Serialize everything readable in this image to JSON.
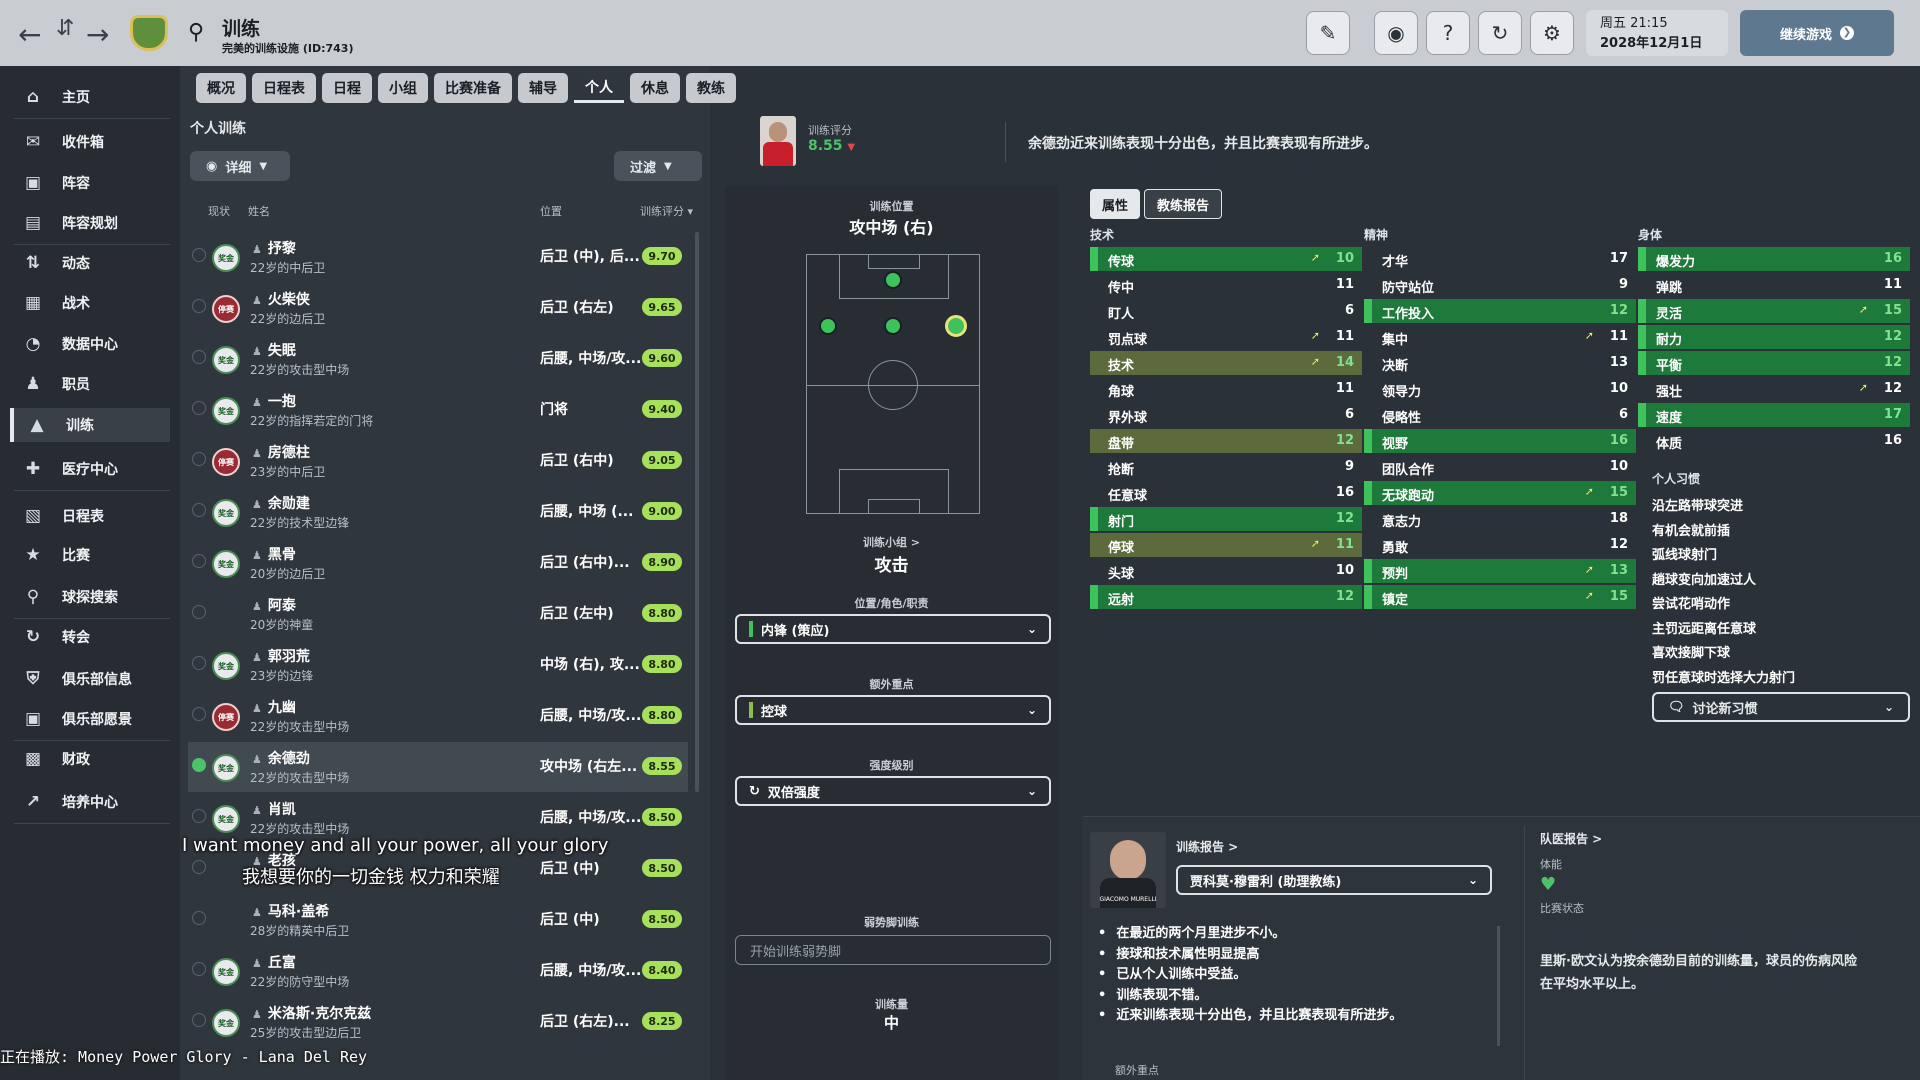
{
  "topbar": {
    "search_icon": "search-icon",
    "title": "训练",
    "subtitle": "完美的训练设施 (ID:743)",
    "date_line1": "周五 21:15",
    "date_line2": "2028年12月1日",
    "continue_label": "继续游戏",
    "icons": [
      "edit-icon",
      "globe-icon",
      "help-icon",
      "refresh-icon",
      "settings-icon"
    ]
  },
  "sidebar": {
    "items": [
      {
        "label": "主页",
        "icon": "home-icon"
      },
      {
        "label": "收件箱",
        "icon": "inbox-icon"
      },
      {
        "label": "阵容",
        "icon": "shirt-icon"
      },
      {
        "label": "阵容规划",
        "icon": "clipboard-icon"
      },
      {
        "label": "动态",
        "icon": "dynamic-icon"
      },
      {
        "label": "战术",
        "icon": "tactics-icon"
      },
      {
        "label": "数据中心",
        "icon": "data-icon"
      },
      {
        "label": "职员",
        "icon": "staff-icon"
      },
      {
        "label": "训练",
        "icon": "training-icon"
      },
      {
        "label": "医疗中心",
        "icon": "medical-icon"
      },
      {
        "label": "日程表",
        "icon": "calendar-icon"
      },
      {
        "label": "比赛",
        "icon": "trophy-icon"
      },
      {
        "label": "球探搜索",
        "icon": "scout-icon"
      },
      {
        "label": "转会",
        "icon": "transfer-icon"
      },
      {
        "label": "俱乐部信息",
        "icon": "shield-icon"
      },
      {
        "label": "俱乐部愿景",
        "icon": "vision-icon"
      },
      {
        "label": "财政",
        "icon": "finance-icon"
      },
      {
        "label": "培养中心",
        "icon": "development-icon"
      }
    ]
  },
  "tabs": [
    "概况",
    "日程表",
    "日程",
    "小组",
    "比赛准备",
    "辅导",
    "个人",
    "休息",
    "教练"
  ],
  "left": {
    "title": "个人训练",
    "detail_label": "详细",
    "filter_label": "过滤",
    "col_status": "现状",
    "col_name": "姓名",
    "col_pos": "位置",
    "col_rating": "训练评分",
    "players": [
      {
        "badge": "奖金",
        "name": "抒黎",
        "desc": "22岁的中后卫",
        "pos": "后卫 (中), 后...",
        "rating": "9.70"
      },
      {
        "badge": "停赛",
        "name": "火柴侠",
        "desc": "22岁的边后卫",
        "pos": "后卫 (右左)",
        "rating": "9.65"
      },
      {
        "badge": "奖金",
        "name": "失眠",
        "desc": "22岁的攻击型中场",
        "pos": "后腰, 中场/攻...",
        "rating": "9.60"
      },
      {
        "badge": "奖金",
        "name": "一抱",
        "desc": "22岁的指挥若定的门将",
        "pos": "门将",
        "rating": "9.40"
      },
      {
        "badge": "停赛",
        "name": "房德柱",
        "desc": "23岁的中后卫",
        "pos": "后卫 (右中)",
        "rating": "9.05"
      },
      {
        "badge": "奖金",
        "name": "余勋建",
        "desc": "22岁的技术型边锋",
        "pos": "后腰, 中场 (...",
        "rating": "9.00"
      },
      {
        "badge": "奖金",
        "name": "黑骨",
        "desc": "20岁的边后卫",
        "pos": "后卫 (右中)...",
        "rating": "8.90"
      },
      {
        "badge": "",
        "name": "阿泰",
        "desc": "20岁的神童",
        "pos": "后卫 (左中)",
        "rating": "8.80"
      },
      {
        "badge": "奖金",
        "name": "郭羽荒",
        "desc": "23岁的边锋",
        "pos": "中场 (右), 攻...",
        "rating": "8.80"
      },
      {
        "badge": "停赛",
        "name": "九幽",
        "desc": "22岁的攻击型中场",
        "pos": "后腰, 中场/攻...",
        "rating": "8.80"
      },
      {
        "badge": "奖金",
        "name": "余德劲",
        "desc": "22岁的攻击型中场",
        "pos": "攻中场 (右左...",
        "rating": "8.55"
      },
      {
        "badge": "奖金",
        "name": "肖凯",
        "desc": "22岁的攻击型中场",
        "pos": "后腰, 中场/攻...",
        "rating": "8.50"
      },
      {
        "badge": "",
        "name": "老孩",
        "desc": "",
        "pos": "后卫 (中)",
        "rating": "8.50"
      },
      {
        "badge": "",
        "name": "马科·盖希",
        "desc": "28岁的精英中后卫",
        "pos": "后卫 (中)",
        "rating": "8.50"
      },
      {
        "badge": "奖金",
        "name": "丘富",
        "desc": "22岁的防守型中场",
        "pos": "后腰, 中场/攻...",
        "rating": "8.40"
      },
      {
        "badge": "奖金",
        "name": "米洛斯·克尔克兹",
        "desc": "25岁的攻击型边后卫",
        "pos": "后卫 (右左)...",
        "rating": "8.25"
      }
    ]
  },
  "overlay": {
    "subtitle_en": "I want money and all your power, all your glory",
    "subtitle_zh": "我想要你的一切金钱 权力和荣耀",
    "now_playing": "正在播放: Money Power Glory - Lana Del Rey"
  },
  "player_header": {
    "rating_label": "训练评分",
    "rating_value": "8.55",
    "comment": "余德劲近来训练表现十分出色，并且比赛表现有所进步。"
  },
  "middle": {
    "pos_label": "训练位置",
    "pos_value": "攻中场 (右)",
    "group_label": "训练小组 >",
    "group_value": "攻击",
    "role_label": "位置/角色/职责",
    "role_value": "内锋 (策应)",
    "focus_label": "额外重点",
    "focus_value": "控球",
    "intensity_label": "强度级别",
    "intensity_value": "双倍强度",
    "weakfoot_label": "弱势脚训练",
    "weakfoot_placeholder": "开始训练弱势脚",
    "load_label": "训练量",
    "load_value": "中"
  },
  "right": {
    "tab_attr": "属性",
    "tab_report": "教练报告",
    "tech_head": "技术",
    "mental_head": "精神",
    "physical_head": "身体",
    "technical": [
      {
        "n": "传球",
        "v": "10",
        "up": true,
        "hl": "g"
      },
      {
        "n": "传中",
        "v": "11",
        "up": false,
        "hl": ""
      },
      {
        "n": "盯人",
        "v": "6",
        "up": false,
        "hl": ""
      },
      {
        "n": "罚点球",
        "v": "11",
        "up": true,
        "hl": ""
      },
      {
        "n": "技术",
        "v": "14",
        "up": true,
        "hl": "o"
      },
      {
        "n": "角球",
        "v": "11",
        "up": false,
        "hl": ""
      },
      {
        "n": "界外球",
        "v": "6",
        "up": false,
        "hl": ""
      },
      {
        "n": "盘带",
        "v": "12",
        "up": false,
        "hl": "o"
      },
      {
        "n": "抢断",
        "v": "9",
        "up": false,
        "hl": ""
      },
      {
        "n": "任意球",
        "v": "16",
        "up": false,
        "hl": ""
      },
      {
        "n": "射门",
        "v": "12",
        "up": false,
        "hl": "g"
      },
      {
        "n": "停球",
        "v": "11",
        "up": true,
        "hl": "o"
      },
      {
        "n": "头球",
        "v": "10",
        "up": false,
        "hl": ""
      },
      {
        "n": "远射",
        "v": "12",
        "up": false,
        "hl": "g"
      }
    ],
    "mental": [
      {
        "n": "才华",
        "v": "17",
        "up": false,
        "hl": ""
      },
      {
        "n": "防守站位",
        "v": "9",
        "up": false,
        "hl": ""
      },
      {
        "n": "工作投入",
        "v": "12",
        "up": false,
        "hl": "g"
      },
      {
        "n": "集中",
        "v": "11",
        "up": true,
        "hl": ""
      },
      {
        "n": "决断",
        "v": "13",
        "up": false,
        "hl": ""
      },
      {
        "n": "领导力",
        "v": "10",
        "up": false,
        "hl": ""
      },
      {
        "n": "侵略性",
        "v": "6",
        "up": false,
        "hl": ""
      },
      {
        "n": "视野",
        "v": "16",
        "up": false,
        "hl": "g"
      },
      {
        "n": "团队合作",
        "v": "10",
        "up": false,
        "hl": ""
      },
      {
        "n": "无球跑动",
        "v": "15",
        "up": true,
        "hl": "g"
      },
      {
        "n": "意志力",
        "v": "18",
        "up": false,
        "hl": ""
      },
      {
        "n": "勇敢",
        "v": "12",
        "up": false,
        "hl": ""
      },
      {
        "n": "预判",
        "v": "13",
        "up": true,
        "hl": "g"
      },
      {
        "n": "镇定",
        "v": "15",
        "up": true,
        "hl": "g"
      }
    ],
    "physical": [
      {
        "n": "爆发力",
        "v": "16",
        "up": false,
        "hl": "g"
      },
      {
        "n": "弹跳",
        "v": "11",
        "up": false,
        "hl": ""
      },
      {
        "n": "灵活",
        "v": "15",
        "up": true,
        "hl": "g"
      },
      {
        "n": "耐力",
        "v": "12",
        "up": false,
        "hl": "g"
      },
      {
        "n": "平衡",
        "v": "12",
        "up": false,
        "hl": "g"
      },
      {
        "n": "强壮",
        "v": "12",
        "up": true,
        "hl": ""
      },
      {
        "n": "速度",
        "v": "17",
        "up": false,
        "hl": "g"
      },
      {
        "n": "体质",
        "v": "16",
        "up": false,
        "hl": ""
      }
    ],
    "habits_head": "个人习惯",
    "habits": [
      "沿左路带球突进",
      "有机会就前插",
      "弧线球射门",
      "趟球变向加速过人",
      "尝试花哨动作",
      "主罚远距离任意球",
      "喜欢接脚下球",
      "罚任意球时选择大力射门"
    ],
    "discuss_label": "讨论新习惯"
  },
  "report": {
    "link": "训练报告 >",
    "coach_select": "贾科莫·穆雷利 (助理教练)",
    "coach_caption": "GIACOMO MURELLI",
    "bullets": [
      "在最近的两个月里进步不小。",
      "接球和技术属性明显提高",
      "已从个人训练中受益。",
      "训练表现不错。",
      "近来训练表现十分出色，并且比赛表现有所进步。"
    ],
    "extra_label": "额外重点",
    "medical_link": "队医报告 >",
    "fitness_label": "体能",
    "match_label": "比赛状态",
    "medical_text_1": "里斯·欧文认为按余德劲目前的训练量，球员的伤病风险",
    "medical_text_2": "在平均水平以上。"
  },
  "colors": {
    "accent_green": "#3ec25c",
    "rating_green": "#a7e05a",
    "highlight": "#1e7a3a",
    "olive": "#5d6a3b",
    "rating_value": "#4ec16b",
    "down_arrow": "#e04848"
  }
}
